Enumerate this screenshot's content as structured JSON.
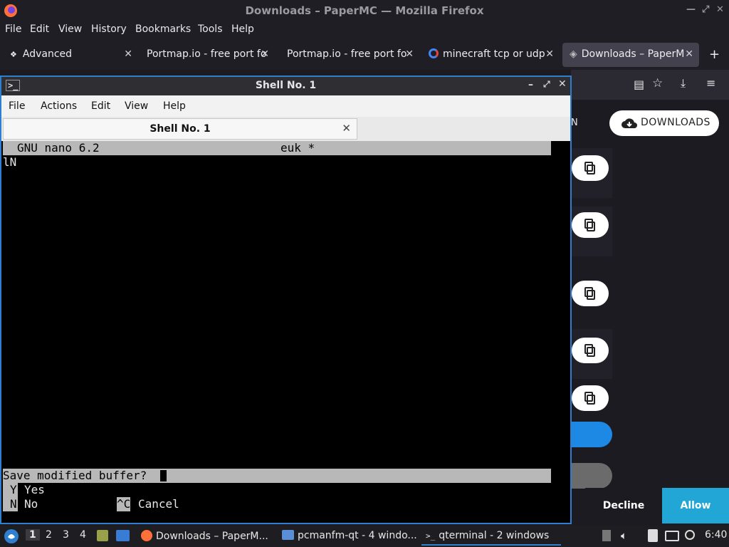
{
  "firefox": {
    "window_title": "Downloads – PaperMC — Mozilla Firefox",
    "menu": [
      "File",
      "Edit",
      "View",
      "History",
      "Bookmarks",
      "Tools",
      "Help"
    ],
    "tabs": [
      {
        "label": "Advanced"
      },
      {
        "label": "Portmap.io - free port fo"
      },
      {
        "label": "Portmap.io - free port fo"
      },
      {
        "label": "minecraft tcp or udp"
      },
      {
        "label": "Downloads – PaperM"
      }
    ],
    "new_tab": "+",
    "page": {
      "downloads_button": "DOWNLOADS",
      "partial_text": "N",
      "decline": "Decline",
      "allow": "Allow"
    }
  },
  "terminal": {
    "title": "Shell No. 1",
    "menu": [
      "File",
      "Actions",
      "Edit",
      "View",
      "Help"
    ],
    "tab_label": "Shell No. 1",
    "nano": {
      "version": "GNU nano 6.2",
      "filename": "euk *",
      "line1": "lN",
      "prompt": "Save modified buffer?",
      "opt_yes_key": "Y",
      "opt_yes": "Yes",
      "opt_no_key": "N",
      "opt_no": "No",
      "opt_cancel_key": "^C",
      "opt_cancel": "Cancel"
    }
  },
  "taskbar": {
    "workspaces": [
      "1",
      "2",
      "3",
      "4"
    ],
    "windows": [
      {
        "label": "Downloads – PaperM..."
      },
      {
        "label": "pcmanfm-qt - 4 windo..."
      },
      {
        "label": "qterminal - 2 windows"
      }
    ],
    "clock": "6:40"
  },
  "colors": {
    "accent": "#2f7fd0",
    "allow": "#21a6d6"
  }
}
